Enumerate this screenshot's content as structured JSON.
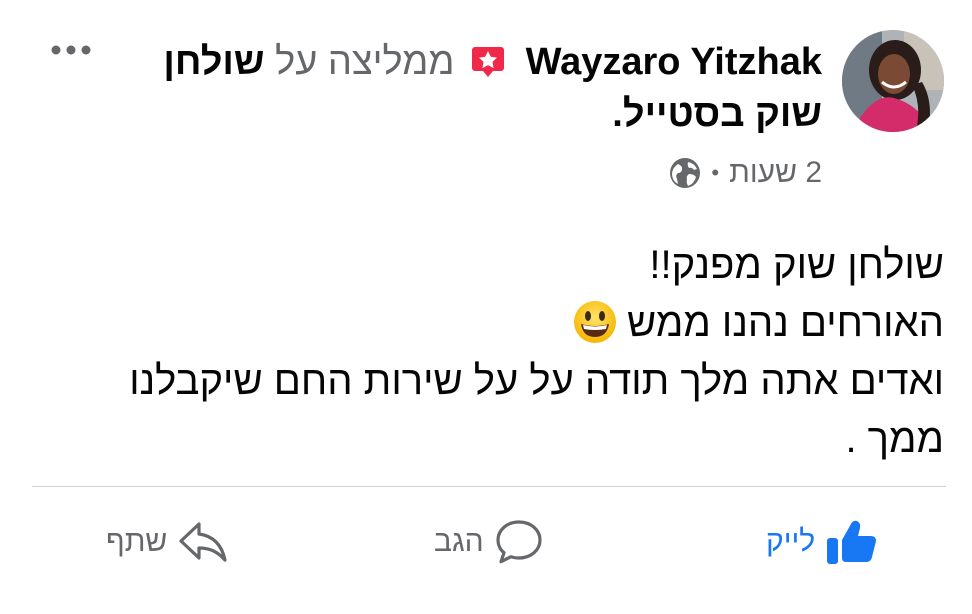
{
  "post": {
    "author": "Wayzaro Yitzhak",
    "recommend_text": "ממליצה על",
    "page_name": "שולחן שוק בסטייל",
    "time": "2 שעות",
    "separator": "•",
    "audience_icon": "globe-icon",
    "more_icon": "more-options-icon",
    "content_lines": [
      "שולחן שוק מפנק!!",
      "האורחים נהנו ממש",
      "ואדים אתה מלך תודה על על שירות החם שיקבלנו ממך ."
    ],
    "emoji": "grinning-face-emoji"
  },
  "actions": {
    "like": "לייק",
    "comment": "הגב",
    "share": "שתף"
  },
  "colors": {
    "like_blue": "#1877f2",
    "recommend_red": "#f02849",
    "secondary_text": "#65676b",
    "divider": "#ced0d4"
  }
}
